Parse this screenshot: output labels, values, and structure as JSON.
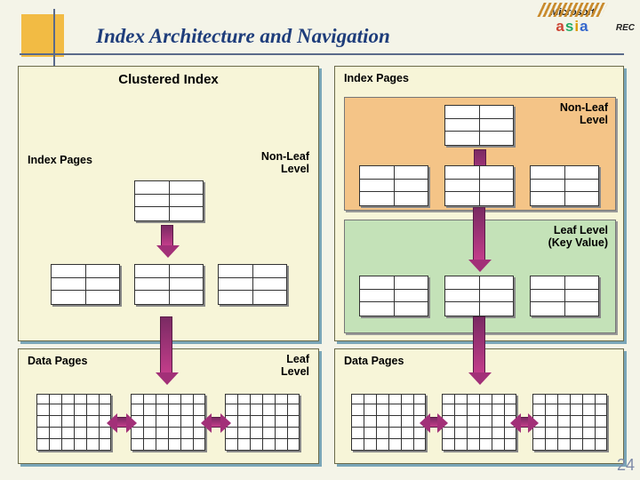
{
  "title": "Index Architecture and Navigation",
  "logo": {
    "top": "Microsoft",
    "bottom": "asia"
  },
  "rec": "REC",
  "page_number": "24",
  "left_panel": {
    "heading": "Clustered Index",
    "label_index_pages": "Index Pages",
    "label_nonleaf": "Non-Leaf\nLevel"
  },
  "right_panel": {
    "label_index_pages": "Index Pages",
    "label_nonleaf": "Non-Leaf\nLevel",
    "label_leaf": "Leaf Level\n(Key Value)"
  },
  "bottom_left": {
    "label_data_pages": "Data Pages",
    "label_leaf": "Leaf\nLevel"
  },
  "bottom_right": {
    "label_data_pages": "Data Pages"
  }
}
